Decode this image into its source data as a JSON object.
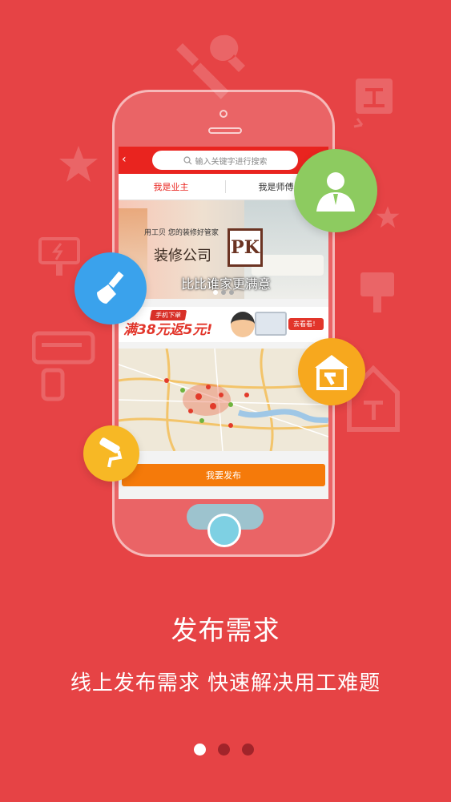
{
  "app_screen": {
    "search": {
      "placeholder": "输入关键字进行搜索",
      "back_icon": "chevron-left-icon",
      "search_icon": "magnifier-icon"
    },
    "tabs": [
      {
        "label": "我是业主",
        "active": true
      },
      {
        "label": "我是师傅",
        "active": false
      }
    ],
    "banner": {
      "subtitle": "用工贝 您的装修好管家",
      "title": "装修公司",
      "pk_mark": "PK",
      "slogan": "比比谁家更满意"
    },
    "promo": {
      "tag": "手机下单",
      "headline": "满38元返5元!",
      "cta": "去看看！"
    },
    "publish_button": "我要发布",
    "colors": {
      "header": "#e9241f",
      "publish": "#f57a0a"
    }
  },
  "floating_icons": [
    {
      "name": "user-icon",
      "color": "#8dcb60"
    },
    {
      "name": "brush-icon",
      "color": "#3aa2ec"
    },
    {
      "name": "house-hammer-icon",
      "color": "#f7a81e"
    },
    {
      "name": "paint-roller-icon",
      "color": "#f7b825"
    }
  ],
  "onboarding": {
    "title": "发布需求",
    "subtitle": "线上发布需求 快速解决用工难题",
    "page_count": 3,
    "current_page": 1
  },
  "colors": {
    "background": "#e64345",
    "dot_inactive": "#a1242a",
    "dot_active": "#ffffff"
  }
}
